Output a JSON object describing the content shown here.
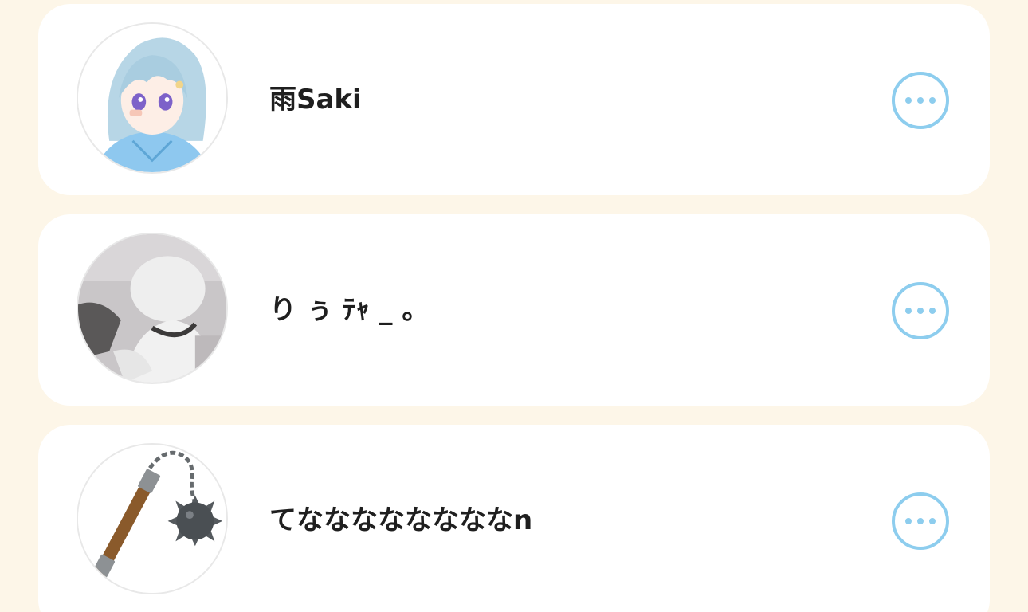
{
  "users": [
    {
      "name": "雨Saki",
      "avatar_icon": "anime-girl-blue-hair-avatar"
    },
    {
      "name": "り ぅ ﾃｬ _ 。",
      "avatar_icon": "white-hair-figure-avatar"
    },
    {
      "name": "てななななななななn",
      "avatar_icon": "flail-weapon-avatar"
    }
  ],
  "more_icon": "more-options-icon",
  "colors": {
    "background": "#fdf6e8",
    "card": "#ffffff",
    "accent": "#8dcdee",
    "text": "#1f1f1f"
  }
}
